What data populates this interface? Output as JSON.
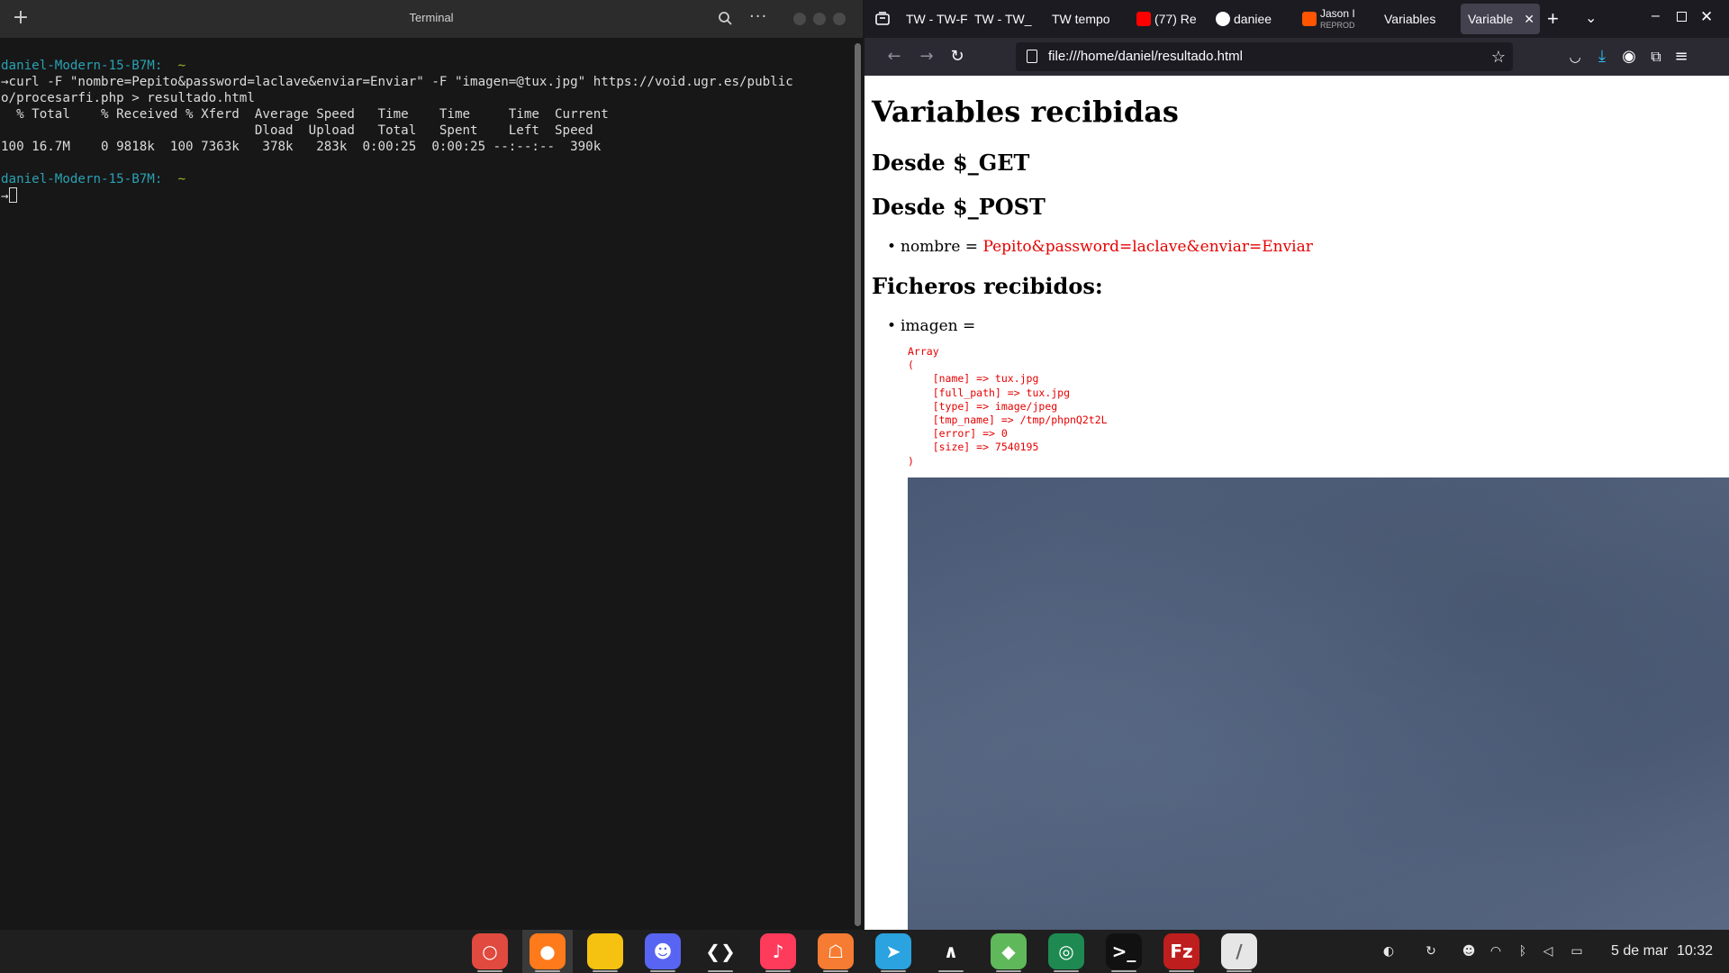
{
  "terminal": {
    "title": "Terminal",
    "new_tab_icon": "plus-icon",
    "lines": [
      {
        "kind": "prompt",
        "host": "daniel-Modern-15-B7M:",
        "tilde": "~"
      },
      {
        "kind": "text",
        "text": "→curl -F \"nombre=Pepito&password=laclave&enviar=Enviar\" -F \"imagen=@tux.jpg\" https://void.ugr.es/public"
      },
      {
        "kind": "text",
        "text": "o/procesarfi.php > resultado.html"
      },
      {
        "kind": "text",
        "text": "  % Total    % Received % Xferd  Average Speed   Time    Time     Time  Current"
      },
      {
        "kind": "text",
        "text": "                                 Dload  Upload   Total   Spent    Left  Speed"
      },
      {
        "kind": "text",
        "text": "100 16.7M    0 9818k  100 7363k   378k   283k  0:00:25  0:00:25 --:--:--  390k"
      },
      {
        "kind": "text",
        "text": ""
      },
      {
        "kind": "prompt",
        "host": "daniel-Modern-15-B7M:",
        "tilde": "~"
      },
      {
        "kind": "cursor",
        "text": "→"
      }
    ]
  },
  "browser": {
    "tabs": [
      {
        "label": "TW - TW-F",
        "icon": "page-icon"
      },
      {
        "label": "TW - TW_",
        "icon": "page-icon"
      },
      {
        "label": "TW tempo",
        "icon": "page-icon"
      },
      {
        "label": "(77) Re",
        "icon": "youtube-icon"
      },
      {
        "label": "daniee",
        "icon": "github-icon"
      },
      {
        "label": "Jason I",
        "sub": "REPROD",
        "icon": "soundcloud-icon"
      },
      {
        "label": "Variables",
        "icon": "page-icon"
      },
      {
        "label": "Variable",
        "icon": "page-icon",
        "active": true
      }
    ],
    "url": "file:///home/daniel/resultado.html",
    "page": {
      "h1": "Variables recibidas",
      "get_heading": "Desde $_GET",
      "post_heading": "Desde $_POST",
      "post_items": [
        {
          "key": "nombre",
          "sep": " = ",
          "value": "Pepito&password=laclave&enviar=Enviar"
        }
      ],
      "files_heading": "Ficheros recibidos:",
      "file_items": [
        {
          "key": "imagen",
          "sep": " ="
        }
      ],
      "array_dump": "Array\n(\n    [name] => tux.jpg\n    [full_path] => tux.jpg\n    [type] => image/jpeg\n    [tmp_name] => /tmp/phpnQ2t2L\n    [error] => 0\n    [size] => 7540195\n)"
    }
  },
  "taskbar": {
    "apps": [
      {
        "name": "screenshot-app-icon",
        "color": "#e04a3f",
        "glyph": "○"
      },
      {
        "name": "firefox-icon",
        "color": "#ff7a1a",
        "glyph": "●",
        "active": true
      },
      {
        "name": "files-icon",
        "color": "#f5c211",
        "glyph": ""
      },
      {
        "name": "discord-icon",
        "color": "#5865f2",
        "glyph": "☻"
      },
      {
        "name": "vscode-icon",
        "color": "#1e1e1e",
        "glyph": "❮❯"
      },
      {
        "name": "music-icon",
        "color": "#ff3b5c",
        "glyph": "♪"
      },
      {
        "name": "store-icon",
        "color": "#f57c32",
        "glyph": "☖"
      },
      {
        "name": "telegram-icon",
        "color": "#2aa3e0",
        "glyph": "➤"
      },
      {
        "name": "kdenlive-icon",
        "color": "#1f1f1f",
        "glyph": "∧"
      },
      {
        "name": "cube-app-icon",
        "color": "#5fb85a",
        "glyph": "◆"
      },
      {
        "name": "globe-app-icon",
        "color": "#1e8a52",
        "glyph": "◎"
      },
      {
        "name": "terminal-app-icon",
        "color": "#111111",
        "glyph": ">_"
      },
      {
        "name": "filezilla-icon",
        "color": "#bf1e1e",
        "glyph": "Fz"
      },
      {
        "name": "text-editor-icon",
        "color": "#e6e6e6",
        "glyph": "/"
      }
    ],
    "tray": [
      "vpn-icon",
      "sync-icon",
      "discord-tray-icon",
      "wifi-icon",
      "bluetooth-icon",
      "volume-icon",
      "battery-icon"
    ],
    "date": "5 de mar",
    "time": "10:32"
  },
  "colors": {
    "terminal_bg": "#171717",
    "prompt_host": "#2aa1b3",
    "prompt_tilde": "#9bb829",
    "php_output_red": "#e60000",
    "browser_chrome": "#1c1b22"
  }
}
